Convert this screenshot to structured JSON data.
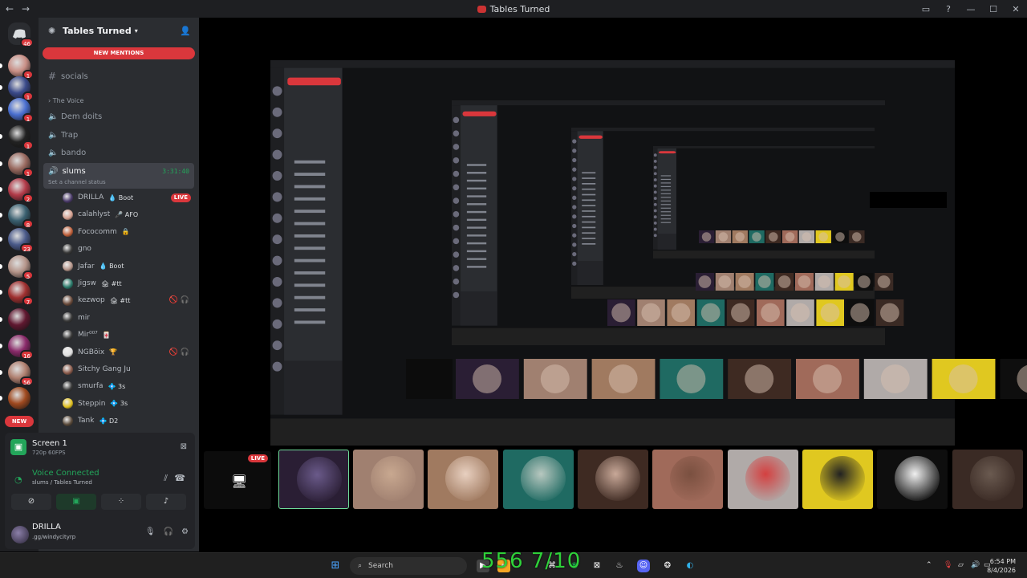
{
  "window": {
    "title": "Tables Turned",
    "nav_back": "←",
    "nav_forward": "→",
    "controls": {
      "inbox": "▭",
      "help": "?",
      "minimize": "—",
      "maximize": "☐",
      "close": "✕"
    }
  },
  "rail": {
    "home_badge": "46",
    "servers": [
      {
        "badge": "1",
        "color": "#c98f86"
      },
      {
        "badge": "1",
        "color": "#3a4a8a"
      },
      {
        "badge": "1",
        "color": "#4a6fd0"
      },
      {
        "badge": "1",
        "color": "#222"
      },
      {
        "badge": "1",
        "color": "#9a6a60"
      },
      {
        "badge": "2",
        "color": "#b23a48"
      },
      {
        "badge": "8",
        "color": "#3a6070"
      },
      {
        "badge": "23",
        "color": "#4a5a8a"
      },
      {
        "badge": "5",
        "color": "#b5958a"
      },
      {
        "badge": "7",
        "color": "#a03030"
      },
      {
        "badge": "",
        "color": "#601830"
      },
      {
        "badge": "16",
        "color": "#8a2a6a"
      },
      {
        "badge": "56",
        "color": "#b08070"
      },
      {
        "badge": "",
        "color": "#a04a20"
      }
    ],
    "new_label": "NEW"
  },
  "sidebar": {
    "server_name": "Tables Turned",
    "new_mentions": "NEW MENTIONS",
    "channels_top": [
      {
        "name": "socials"
      }
    ],
    "category": "The Voice",
    "voice_channels": [
      "Dem doits",
      "Trap",
      "bando"
    ],
    "active_channel": {
      "name": "slums",
      "timer": "3:31:40",
      "status": "Set a channel status"
    },
    "voice_users": [
      {
        "name": "DRILLA",
        "tag": "💧 Boot",
        "live": "LIVE",
        "color": "#4a3a6a",
        "icons": ""
      },
      {
        "name": "calahlyst",
        "tag": "🎤 AFO",
        "live": "",
        "color": "#d4a090",
        "icons": ""
      },
      {
        "name": "Fococomm",
        "tag": "🔒",
        "live": "",
        "color": "#c0603a",
        "icons": ""
      },
      {
        "name": "gno",
        "tag": "",
        "live": "",
        "color": "#3a3a3a",
        "icons": ""
      },
      {
        "name": "Jafar",
        "tag": "💧 Boot",
        "live": "",
        "color": "#b5958a",
        "icons": ""
      },
      {
        "name": "Jigsw",
        "tag": "🏚 #tt",
        "live": "",
        "color": "#2a7a6a",
        "icons": ""
      },
      {
        "name": "kezwop",
        "tag": "🏚 #tt",
        "live": "",
        "color": "#6a4a3a",
        "icons": "🚫 🎧"
      },
      {
        "name": "mir",
        "tag": "",
        "live": "",
        "color": "#3a3a3a",
        "icons": ""
      },
      {
        "name": "Mir⁰⁰⁷",
        "tag": "🀄",
        "live": "",
        "color": "#3a3a3a",
        "icons": ""
      },
      {
        "name": "NGBöix",
        "tag": "🏆",
        "live": "",
        "color": "#e0e0e0",
        "icons": "🚫 🎧"
      },
      {
        "name": "Sitchy Gang Ju",
        "tag": "",
        "live": "",
        "color": "#8a5a4a",
        "icons": ""
      },
      {
        "name": "smurfa",
        "tag": "💠 3s",
        "live": "",
        "color": "#3a3a3a",
        "icons": ""
      },
      {
        "name": "Steppin",
        "tag": "💠 3s",
        "live": "",
        "color": "#e0c020",
        "icons": ""
      },
      {
        "name": "Tank",
        "tag": "💠 D2",
        "live": "",
        "color": "#5a4a3a",
        "icons": ""
      }
    ]
  },
  "panel": {
    "screen_title": "Screen 1",
    "screen_quality": "720p 60FPS",
    "voice_status": "Voice Connected",
    "voice_location": "slums / Tables Turned",
    "user_name": "DRILLA",
    "user_status": ".gg/windycityrp"
  },
  "stage": {
    "live": "LIVE",
    "tiles": [
      {
        "color": "#2a1e34",
        "accent": "#6a5a8a"
      },
      {
        "color": "#a08070",
        "accent": "#c8a890"
      },
      {
        "color": "#a07a60",
        "accent": "#e8d0c0"
      },
      {
        "color": "#1f6a62",
        "accent": "#b8c8c0"
      },
      {
        "color": "#3e2a22",
        "accent": "#c8a898"
      },
      {
        "color": "#a06a5a",
        "accent": "#7a5040"
      },
      {
        "color": "#b0aaa8",
        "accent": "#d44040"
      },
      {
        "color": "#e0c820",
        "accent": "#222222"
      },
      {
        "color": "#0e0e0e",
        "accent": "#f0f0f0"
      },
      {
        "color": "#3a2a24",
        "accent": "#6a5a50"
      }
    ]
  },
  "taskbar": {
    "search": "Search",
    "time": "6:54 PM",
    "date": "8/4/2026"
  },
  "overlay_text": "556 7/10"
}
